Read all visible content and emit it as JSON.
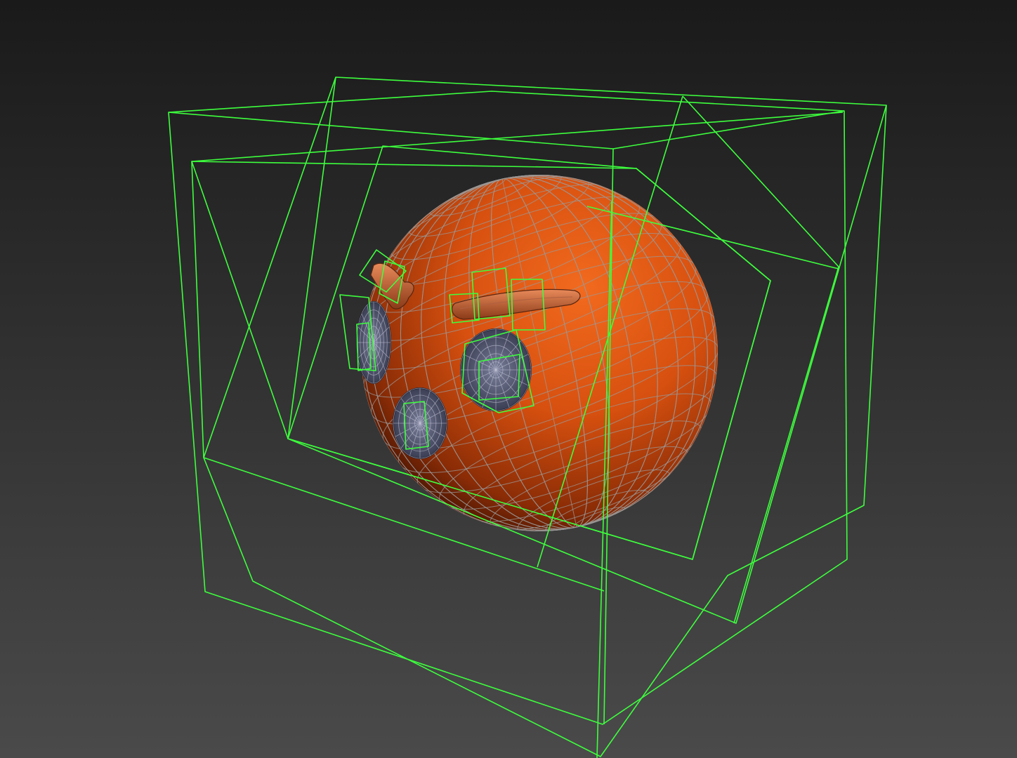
{
  "viewport": {
    "background_top": "#1a1a1a",
    "background_bottom": "#4a4a4a",
    "selection_color": "#3dff3d",
    "wire_color": "#9a9a9a",
    "sphere_color_light": "#f2641c",
    "sphere_color_dark": "#3a0f02",
    "socket_color": "#5a5f7a"
  },
  "scene_objects": [
    "sphere",
    "outer-box-1",
    "outer-box-2",
    "inner-frame",
    "eye-socket-left",
    "eye-socket-right",
    "mouth-socket",
    "eyebrow",
    "horn"
  ]
}
